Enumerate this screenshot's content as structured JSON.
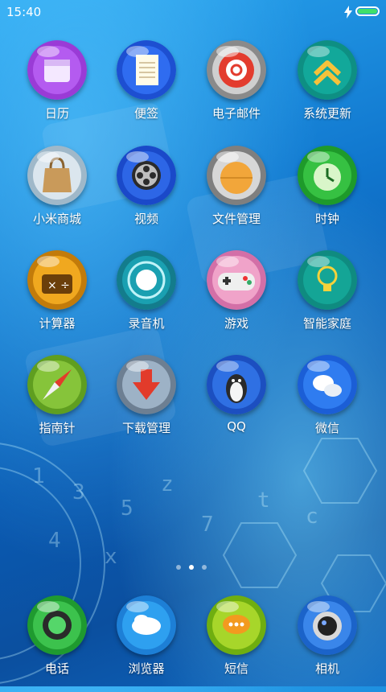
{
  "status_bar": {
    "time": "15:40",
    "battery_color": "#3fe06a"
  },
  "apps": [
    {
      "label": "日历",
      "icon": "calendar-icon"
    },
    {
      "label": "便签",
      "icon": "notes-icon"
    },
    {
      "label": "电子邮件",
      "icon": "email-icon"
    },
    {
      "label": "系统更新",
      "icon": "update-icon"
    },
    {
      "label": "小米商城",
      "icon": "shopping-bag-icon"
    },
    {
      "label": "视频",
      "icon": "film-reel-icon"
    },
    {
      "label": "文件管理",
      "icon": "folder-icon"
    },
    {
      "label": "时钟",
      "icon": "clock-icon"
    },
    {
      "label": "计算器",
      "icon": "calculator-icon"
    },
    {
      "label": "录音机",
      "icon": "recorder-icon"
    },
    {
      "label": "游戏",
      "icon": "gamepad-icon"
    },
    {
      "label": "智能家庭",
      "icon": "lightbulb-icon"
    },
    {
      "label": "指南针",
      "icon": "compass-icon"
    },
    {
      "label": "下载管理",
      "icon": "download-arrow-icon"
    },
    {
      "label": "QQ",
      "icon": "penguin-icon"
    },
    {
      "label": "微信",
      "icon": "chat-bubbles-icon"
    }
  ],
  "page_indicator": {
    "pages": 3,
    "current": 2
  },
  "dock": [
    {
      "label": "电话",
      "icon": "phone-icon"
    },
    {
      "label": "浏览器",
      "icon": "browser-icon"
    },
    {
      "label": "短信",
      "icon": "message-icon"
    },
    {
      "label": "相机",
      "icon": "camera-icon"
    }
  ]
}
